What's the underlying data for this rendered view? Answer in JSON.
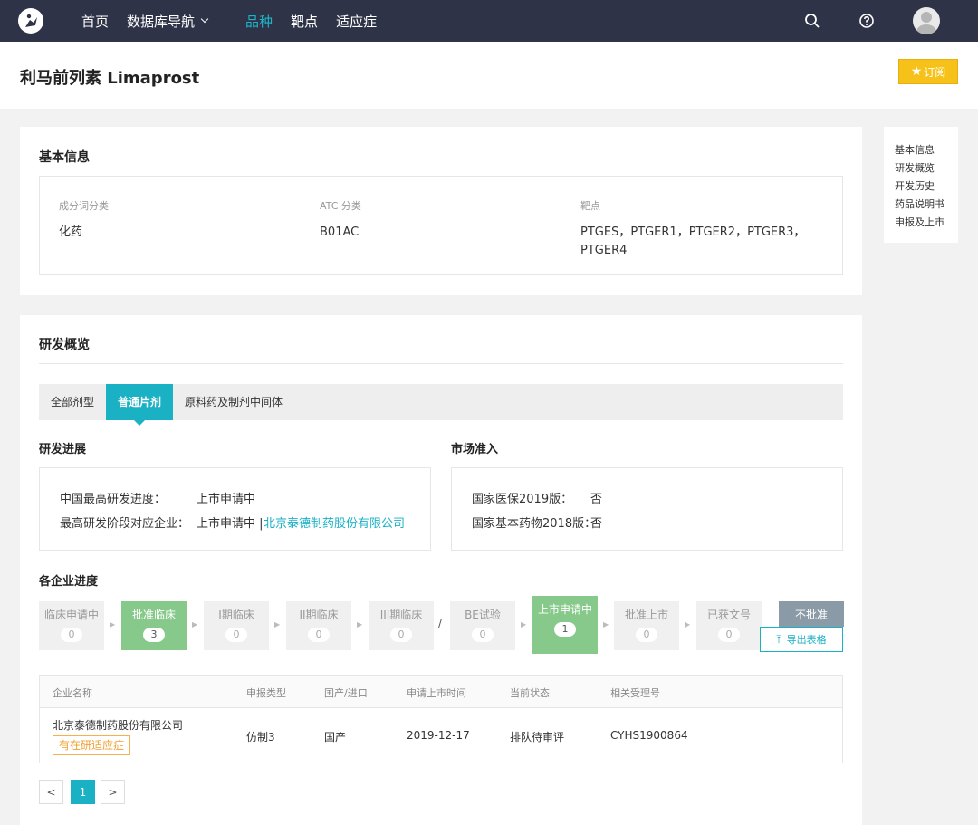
{
  "nav": {
    "items": [
      "首页",
      "数据库导航",
      "品种",
      "靶点",
      "适应症"
    ],
    "icons": [
      "search-icon",
      "help-icon",
      "avatar"
    ]
  },
  "page": {
    "title": "利马前列素 Limaprost",
    "subscribe_label": "订阅"
  },
  "toc": [
    "基本信息",
    "研发概览",
    "开发历史",
    "药品说明书",
    "申报及上市"
  ],
  "basic": {
    "title": "基本信息",
    "fields": [
      {
        "label": "成分词分类",
        "value": "化药"
      },
      {
        "label": "ATC 分类",
        "value": "B01AC"
      },
      {
        "label": "靶点",
        "value": "PTGES，PTGER1，PTGER2，PTGER3，PTGER4"
      }
    ]
  },
  "overview": {
    "title": "研发概览",
    "tabs": [
      "全部剂型",
      "普通片剂",
      "原料药及制剂中间体"
    ],
    "active_tab": 1,
    "progress": {
      "title": "研发进展",
      "highest_label": "中国最高研发进度：",
      "highest_value": "上市申请中",
      "company_label": "最高研发阶段对应企业：",
      "company_status": "上市申请中 |",
      "company_name": "北京泰德制药股份有限公司"
    },
    "market": {
      "title": "市场准入",
      "insurance_label": "国家医保2019版：",
      "insurance_value": "否",
      "essential_label": "国家基本药物2018版：",
      "essential_value": "否"
    },
    "stages_title": "各企业进度",
    "stages": [
      {
        "name": "临床申请中",
        "count": "0"
      },
      {
        "name": "批准临床",
        "count": "3"
      },
      {
        "name": "I期临床",
        "count": "0"
      },
      {
        "name": "II期临床",
        "count": "0"
      },
      {
        "name": "III期临床",
        "count": "0"
      },
      {
        "name": "BE试验",
        "count": "0"
      },
      {
        "name": "上市申请中",
        "count": "1"
      },
      {
        "name": "批准上市",
        "count": "0"
      },
      {
        "name": "已获文号",
        "count": "0"
      },
      {
        "name": "不批准"
      }
    ],
    "export_label": "导出表格",
    "table": {
      "headers": [
        "企业名称",
        "申报类型",
        "国产/进口",
        "申请上市时间",
        "当前状态",
        "相关受理号"
      ],
      "rows": [
        {
          "company": "北京泰德制药股份有限公司",
          "badge": "有在研适应症",
          "type": "仿制3",
          "origin": "国产",
          "date": "2019-12-17",
          "status": "排队待审评",
          "accept_no": "CYHS1900864"
        }
      ]
    },
    "pager": {
      "prev": "<",
      "current": "1",
      "next": ">"
    }
  }
}
